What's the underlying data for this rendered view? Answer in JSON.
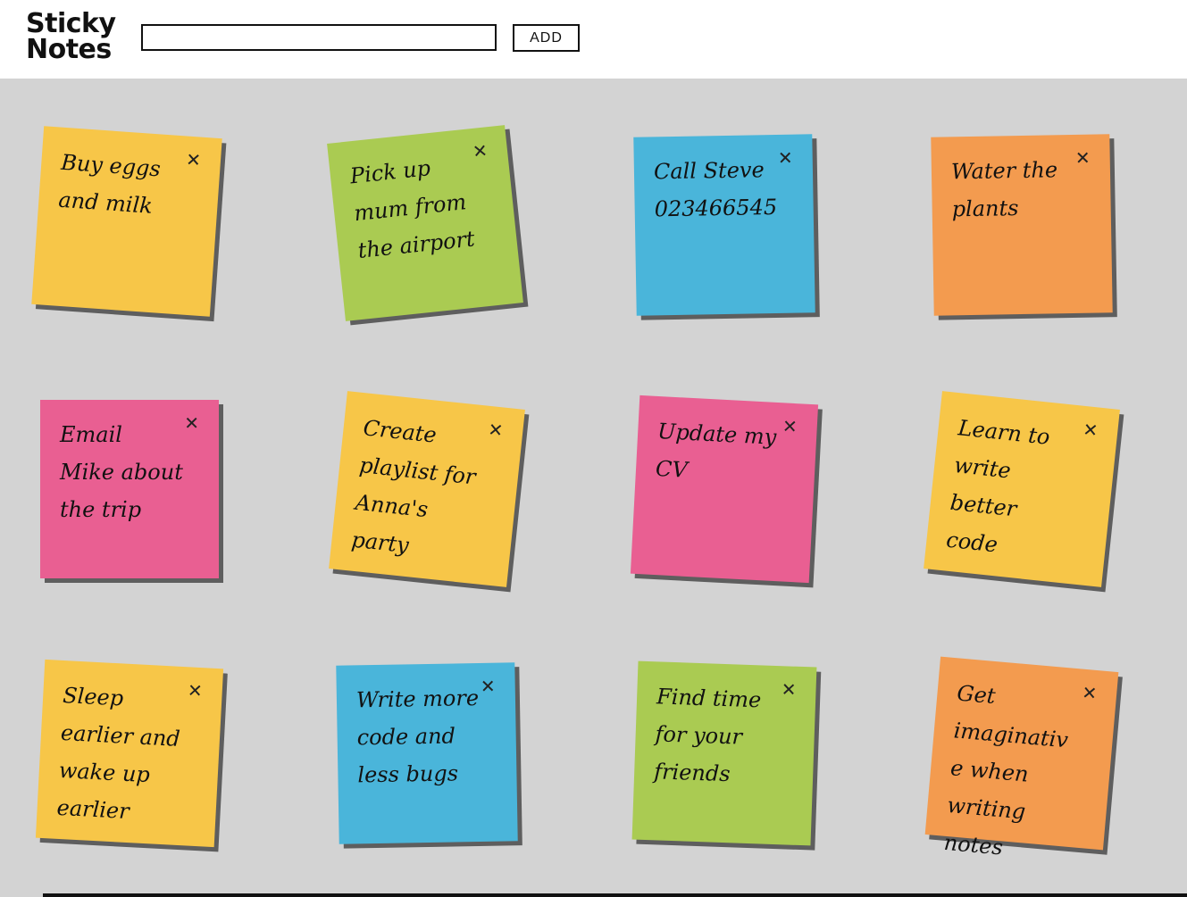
{
  "header": {
    "brand_line1": "Sticky",
    "brand_line2": "Notes",
    "input_value": "",
    "add_label": "ADD"
  },
  "notes": [
    {
      "text": "Buy eggs and milk",
      "color": "#f7c648"
    },
    {
      "text": "Pick up mum from the airport",
      "color": "#aacb52"
    },
    {
      "text": "Call Steve 023466545",
      "color": "#4ab5da"
    },
    {
      "text": "Water the plants",
      "color": "#f39b4f"
    },
    {
      "text": "Email Mike about the trip",
      "color": "#e95f92"
    },
    {
      "text": "Create playlist for Anna's party",
      "color": "#f7c648"
    },
    {
      "text": "Update my CV",
      "color": "#e95f92"
    },
    {
      "text": "Learn to write better code",
      "color": "#f7c648"
    },
    {
      "text": "Sleep earlier and wake up earlier",
      "color": "#f7c648"
    },
    {
      "text": "Write more code and less bugs",
      "color": "#4ab5da"
    },
    {
      "text": "Find time for your friends",
      "color": "#aacb52"
    },
    {
      "text": "Get imaginative when writing notes",
      "color": "#f39b4f"
    }
  ],
  "close_symbol": "✕",
  "icons": {
    "close": "close-icon"
  }
}
